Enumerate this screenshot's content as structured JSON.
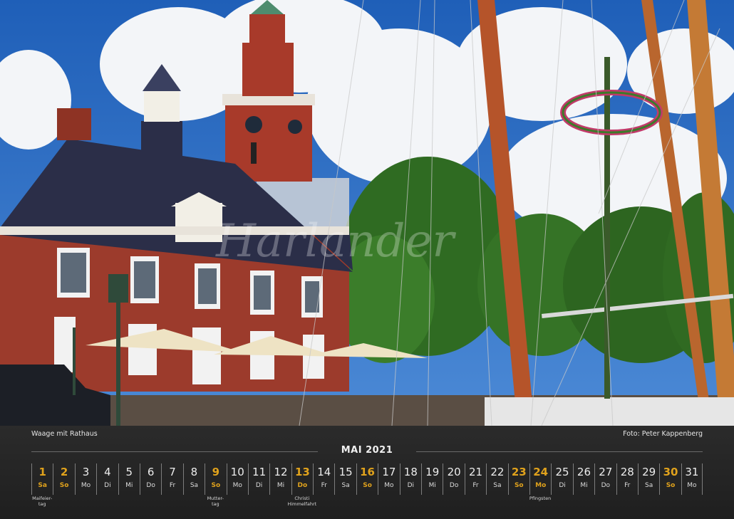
{
  "caption": {
    "title": "Waage mit Rathaus",
    "credit": "Foto: Peter Kappenberg"
  },
  "watermark": "Harlander",
  "month": "MAI 2021",
  "days": [
    {
      "n": "1",
      "wd": "Sa",
      "hl": true
    },
    {
      "n": "2",
      "wd": "So",
      "hl": true
    },
    {
      "n": "3",
      "wd": "Mo",
      "hl": false
    },
    {
      "n": "4",
      "wd": "Di",
      "hl": false
    },
    {
      "n": "5",
      "wd": "Mi",
      "hl": false
    },
    {
      "n": "6",
      "wd": "Do",
      "hl": false
    },
    {
      "n": "7",
      "wd": "Fr",
      "hl": false
    },
    {
      "n": "8",
      "wd": "Sa",
      "hl": false
    },
    {
      "n": "9",
      "wd": "So",
      "hl": true
    },
    {
      "n": "10",
      "wd": "Mo",
      "hl": false
    },
    {
      "n": "11",
      "wd": "Di",
      "hl": false
    },
    {
      "n": "12",
      "wd": "Mi",
      "hl": false
    },
    {
      "n": "13",
      "wd": "Do",
      "hl": true
    },
    {
      "n": "14",
      "wd": "Fr",
      "hl": false
    },
    {
      "n": "15",
      "wd": "Sa",
      "hl": false
    },
    {
      "n": "16",
      "wd": "So",
      "hl": true
    },
    {
      "n": "17",
      "wd": "Mo",
      "hl": false
    },
    {
      "n": "18",
      "wd": "Di",
      "hl": false
    },
    {
      "n": "19",
      "wd": "Mi",
      "hl": false
    },
    {
      "n": "20",
      "wd": "Do",
      "hl": false
    },
    {
      "n": "21",
      "wd": "Fr",
      "hl": false
    },
    {
      "n": "22",
      "wd": "Sa",
      "hl": false
    },
    {
      "n": "23",
      "wd": "So",
      "hl": true
    },
    {
      "n": "24",
      "wd": "Mo",
      "hl": true
    },
    {
      "n": "25",
      "wd": "Di",
      "hl": false
    },
    {
      "n": "26",
      "wd": "Mi",
      "hl": false
    },
    {
      "n": "27",
      "wd": "Do",
      "hl": false
    },
    {
      "n": "28",
      "wd": "Fr",
      "hl": false
    },
    {
      "n": "29",
      "wd": "Sa",
      "hl": false
    },
    {
      "n": "30",
      "wd": "So",
      "hl": true
    },
    {
      "n": "31",
      "wd": "Mo",
      "hl": false
    }
  ],
  "holidays": [
    {
      "day": "1",
      "line1": "Maifeier-",
      "line2": "tag"
    },
    {
      "day": "9",
      "line1": "Mutter-",
      "line2": "tag"
    },
    {
      "day": "13",
      "line1": "Christi",
      "line2": "Himmelfahrt"
    },
    {
      "day": "24",
      "line1": "Pfingsten",
      "line2": ""
    }
  ],
  "colors": {
    "highlight": "#e0a21c",
    "band": "#262626",
    "sky": "#2f6fc4",
    "brick": "#9c3b2c"
  }
}
